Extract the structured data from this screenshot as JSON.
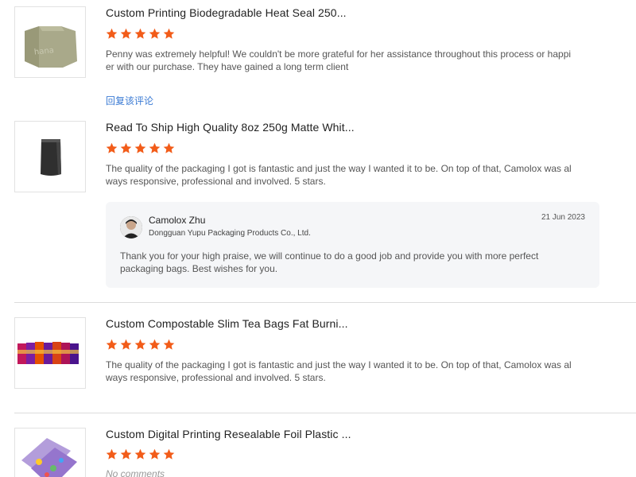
{
  "reviews": [
    {
      "title": "Custom Printing Biodegradable Heat Seal 250...",
      "rating": 5,
      "text": "Penny was extremely helpful! We couldn't be more grateful for her assistance throughout this process or happier with our purchase. They have gained a long term client",
      "reply_link": "回复该评论",
      "thumb_icon": "kraft-pouch-image"
    },
    {
      "title": "Read To Ship High Quality 8oz 250g Matte Whit...",
      "rating": 5,
      "text": "The quality of the packaging I got is fantastic and just the way I wanted it to be. On top of that, Camolox was always responsive, professional and involved. 5 stars.",
      "thumb_icon": "black-stand-up-pouch-image",
      "seller_reply": {
        "name": "Camolox Zhu",
        "company": "Dongguan Yupu Packaging Products Co., Ltd.",
        "date": "21 Jun 2023",
        "text": "Thank you for your high praise, we will continue to do a good job and provide you with more perfect packaging bags. Best wishes for you."
      }
    },
    {
      "title": "Custom Compostable Slim Tea Bags Fat Burni...",
      "rating": 5,
      "text": "The quality of the packaging I got is fantastic and just the way I wanted it to be. On top of that, Camolox was always responsive, professional and involved. 5 stars.",
      "thumb_icon": "tea-bags-row-image"
    },
    {
      "title": "Custom Digital Printing Resealable Foil Plastic ...",
      "rating": 5,
      "text": "No comments",
      "thumb_icon": "foil-bags-image"
    }
  ],
  "colors": {
    "star": "#f25c19",
    "link": "#3b7bd4",
    "reply_bg": "#f5f6f8"
  }
}
